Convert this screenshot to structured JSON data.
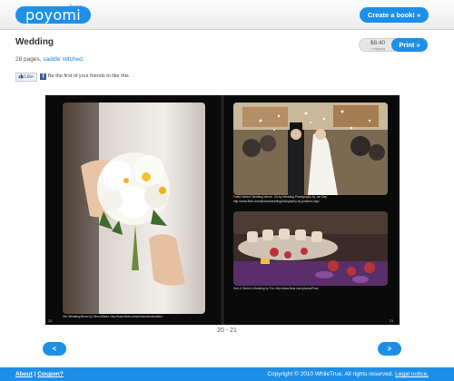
{
  "header": {
    "logo": "poyomi",
    "beta": "beta",
    "create_button": "Create a book! »"
  },
  "book": {
    "title": "Wedding",
    "price": "$8.40",
    "shipping": "+ shipping",
    "print_button": "Print »",
    "pages_text": "28 pages,",
    "binding_link": "saddle stitched",
    "binding_suffix": "."
  },
  "social": {
    "like_label": "Like",
    "like_text": "Be the first of your friends to like this."
  },
  "spread": {
    "left_caption": "Our Wedding Album by SimonSteas. http://www.flickr.com/photos/simonsteas/",
    "right_top_caption": "Fabio! Maleo! Wedding Venue - Dc by Wedding Photography by Jon Day",
    "right_top_caption_2": "http://www.flickr.com/photos/weddingphotography-by-jonathan-day/",
    "right_bottom_caption": "Sue & Stoner's Wedding by Fra. http://www.flickr.com/photos/Frau/",
    "left_page_num": "20",
    "right_page_num": "21",
    "indicator": "20 - 21"
  },
  "nav": {
    "prev": "<",
    "next": ">"
  },
  "footer": {
    "about": "About",
    "separator": "|",
    "coupon": "Coupon?",
    "copyright": "Copyright © 2010 WhileTrue. All rights reserved.",
    "legal": "Legal notice."
  },
  "colors": {
    "accent": "#1e8fe6",
    "facebook": "#3b5998"
  }
}
